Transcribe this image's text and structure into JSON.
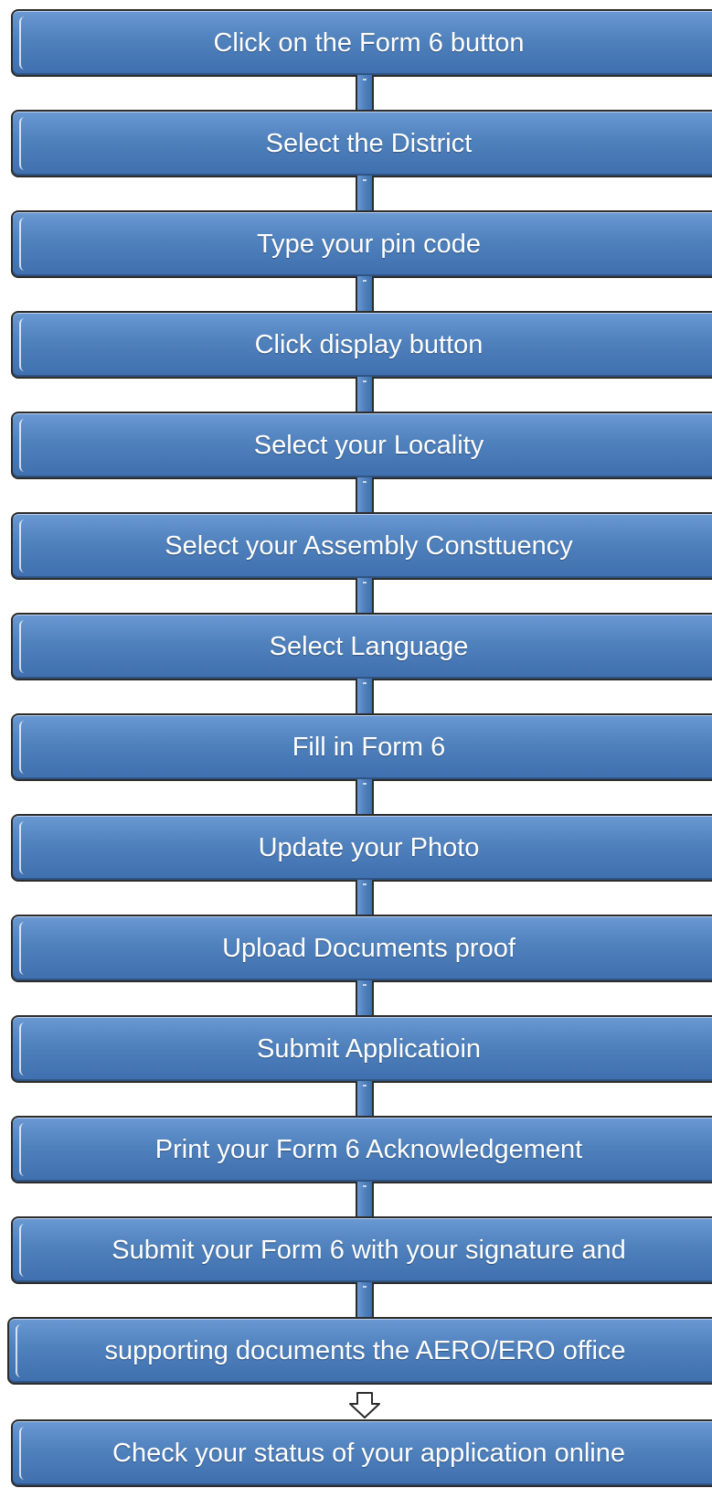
{
  "diagram": {
    "steps": [
      "Click on the Form 6 button",
      "Select the District",
      "Type your pin code",
      "Click display button",
      "Select your Locality",
      "Select your Assembly Consttuency",
      "Select  Language",
      "Fill in Form 6",
      "Update your Photo",
      "Upload Documents proof",
      "Submit Applicatioin",
      "Print your Form 6 Acknowledgement",
      "Submit your Form 6 with your signature and",
      "supporting documents the AERO/ERO office",
      "Check your status  of your application online"
    ]
  },
  "colors": {
    "box_fill": "#4f81bd",
    "box_border": "#2c2c2c",
    "text": "#ffffff"
  }
}
